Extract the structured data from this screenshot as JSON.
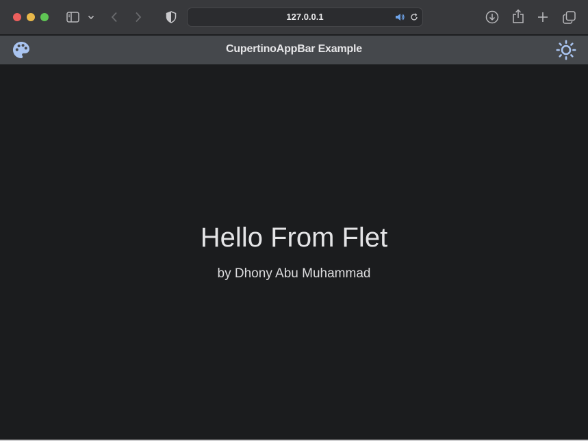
{
  "browser": {
    "url": "127.0.0.1",
    "icons": [
      "sidebar-icon",
      "chevron-down-icon",
      "back-icon",
      "forward-icon",
      "shield-icon",
      "speaker-icon",
      "reload-icon",
      "download-icon",
      "share-icon",
      "new-tab-icon",
      "tabs-overview-icon"
    ]
  },
  "appbar": {
    "title": "CupertinoAppBar Example",
    "leading_icon": "palette-icon",
    "trailing_icon": "sun-icon",
    "icon_color": "#a9c4f0"
  },
  "content": {
    "title": "Hello From Flet",
    "subtitle": "by Dhony Abu Muhammad"
  }
}
